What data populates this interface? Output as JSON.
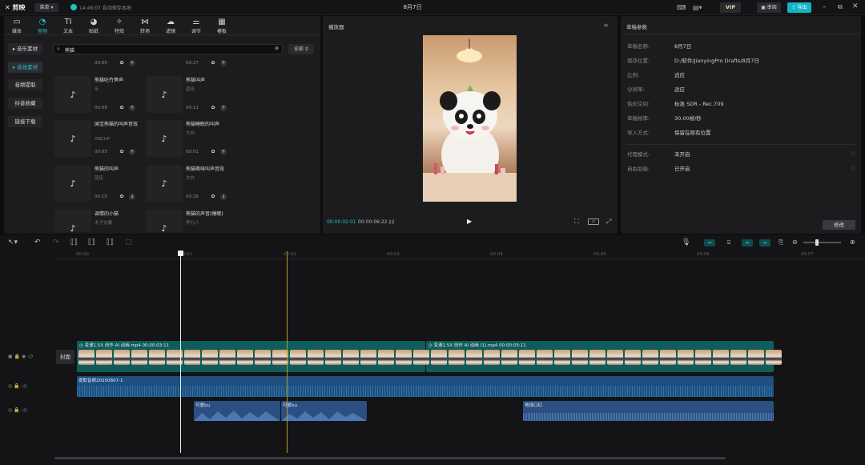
{
  "titlebar": {
    "logo": "剪映",
    "menu_label": "菜单",
    "autosave": "14:46:07 自动保存本地",
    "project_title": "8月7日",
    "vip_label": "VIP",
    "review_label": "审阅",
    "export_label": "导出"
  },
  "tabs": [
    {
      "label": "媒体",
      "icon": "media-icon"
    },
    {
      "label": "音频",
      "icon": "audio-icon"
    },
    {
      "label": "文本",
      "icon": "text-icon"
    },
    {
      "label": "贴纸",
      "icon": "sticker-icon"
    },
    {
      "label": "特效",
      "icon": "effects-icon"
    },
    {
      "label": "转场",
      "icon": "transition-icon"
    },
    {
      "label": "滤镜",
      "icon": "filter-icon"
    },
    {
      "label": "调节",
      "icon": "adjust-icon"
    },
    {
      "label": "模板",
      "icon": "template-icon"
    }
  ],
  "sidebar": [
    "音乐素材",
    "音效素材",
    "音频提取",
    "抖音收藏",
    "链接下载"
  ],
  "search": {
    "value": "熊猫",
    "filter_label": "全部"
  },
  "cards": [
    {
      "title": "",
      "sub": "",
      "duration": "00:05"
    },
    {
      "title": "",
      "sub": "",
      "duration": "00:27"
    },
    {
      "title": "熊猫吃竹笋声",
      "sub": "乐",
      "duration": "00:08"
    },
    {
      "title": "熊猫叫声",
      "sub": "蓝佳",
      "duration": "00:11"
    },
    {
      "title": "国宝熊猫的叫声音效",
      "sub": "XNCUP",
      "duration": "00:05"
    },
    {
      "title": "熊猫睡眠的叫声",
      "sub": "大白",
      "duration": "00:01"
    },
    {
      "title": "熊猫的叫声",
      "sub": "蓝佳",
      "duration": "00:10"
    },
    {
      "title": "熊猫嘶哑叫声音效",
      "sub": "大白",
      "duration": "00:26"
    },
    {
      "title": "调情的小猫",
      "sub": "木子交瓣",
      "duration": ""
    },
    {
      "title": "熊猫的声音(睡眠)",
      "sub": "李九八",
      "duration": ""
    }
  ],
  "player": {
    "title": "播放器",
    "current_time": "00:00:02:01",
    "total_time": "00:00:06:22"
  },
  "props": {
    "title": "草稿参数",
    "rows": [
      {
        "label": "草稿名称:",
        "value": "8月7日"
      },
      {
        "label": "保存位置:",
        "value": "D:/软件/JianyingPro Drafts/8月7日"
      },
      {
        "label": "比例:",
        "value": "适应"
      },
      {
        "label": "分辨率:",
        "value": "适应"
      },
      {
        "label": "色彩空间:",
        "value": "标准 SDR - Rec.709"
      },
      {
        "label": "草稿帧率:",
        "value": "30.00帧/秒"
      },
      {
        "label": "导入方式:",
        "value": "保留在原有位置"
      },
      {
        "label": "代理模式:",
        "value": "未开启"
      },
      {
        "label": "自由层级:",
        "value": "已开启"
      }
    ],
    "edit_label": "修改"
  },
  "timeline": {
    "ruler": [
      "00:00",
      "00:01",
      "00:02",
      "00:03",
      "00:04",
      "00:05",
      "00:06",
      "00:07"
    ],
    "cover_label": "封面",
    "clip1": {
      "speed": "变速1.5X",
      "name": "创作 AI 动画.mp4",
      "duration": "00:00:03:11"
    },
    "clip2": {
      "speed": "变速1.5X",
      "name": "创作 AI 动画 (1).mp4",
      "duration": "00:00:03:11"
    },
    "audio_main": "提取音频20250807-1",
    "audio_a": "可爱bu",
    "audio_b": "可爱bu",
    "audio_c": "地球口红"
  },
  "colors": {
    "accent": "#22c2c6",
    "audio": "#1d4f7f",
    "video_head": "#0f5d5a",
    "export": "#14b3c7"
  }
}
